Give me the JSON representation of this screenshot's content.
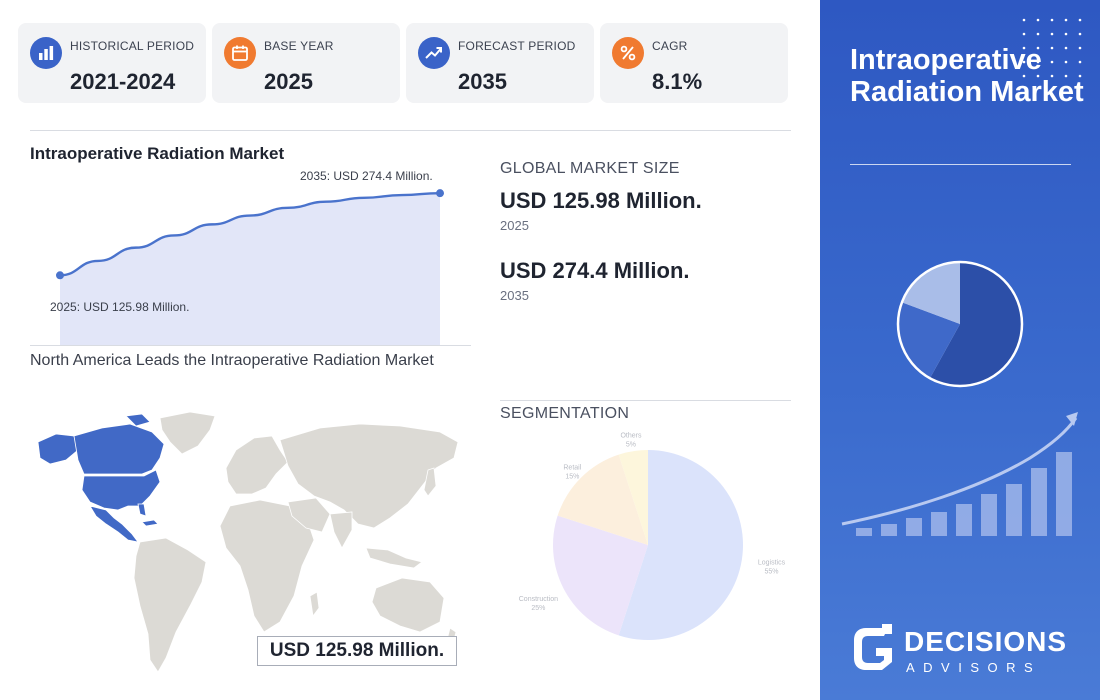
{
  "stats": [
    {
      "label": "HISTORICAL PERIOD",
      "value": "2021-2024",
      "icon": "bar-chart-icon",
      "color": "#3a63c8"
    },
    {
      "label": "BASE YEAR",
      "value": "2025",
      "icon": "calendar-icon",
      "color": "#f07a30"
    },
    {
      "label": "FORECAST PERIOD",
      "value": "2035",
      "icon": "trend-up-icon",
      "color": "#3a63c8"
    },
    {
      "label": "CAGR",
      "value": "8.1%",
      "icon": "percent-icon",
      "color": "#f07a30"
    }
  ],
  "market_chart": {
    "title": "Intraoperative Radiation Market",
    "start_label": "2025: USD 125.98 Million.",
    "end_label": "2035: USD 274.4 Million."
  },
  "market_size": {
    "heading": "GLOBAL MARKET SIZE",
    "value_2025": "USD 125.98 Million.",
    "year_2025": "2025",
    "value_2035": "USD 274.4 Million.",
    "year_2035": "2035"
  },
  "map": {
    "title": "North America Leads the Intraoperative Radiation Market",
    "badge": "USD 125.98 Million.",
    "highlight_color": "#4169c6",
    "base_color": "#dcdad5"
  },
  "segmentation": {
    "heading": "SEGMENTATION"
  },
  "panel": {
    "title": "Intraoperative Radiation Market",
    "logo_main": "DECISIONS",
    "logo_sub": "ADVISORS"
  },
  "chart_data": [
    {
      "type": "area",
      "title": "Intraoperative Radiation Market",
      "x": [
        2025,
        2026,
        2027,
        2028,
        2029,
        2030,
        2031,
        2032,
        2033,
        2034,
        2035
      ],
      "y": [
        125.98,
        152,
        176,
        198,
        218,
        234,
        248,
        259,
        266,
        271,
        274.4
      ],
      "unit": "USD Million",
      "point_labels": {
        "2025": "2025: USD 125.98 Million.",
        "2035": "2035: USD 274.4 Million."
      },
      "color": "#4a73cc",
      "fill": "#e2e6f8"
    },
    {
      "type": "pie",
      "categories": [
        "Logistics",
        "Construction",
        "Retail",
        "Others"
      ],
      "values": [
        55,
        25,
        15,
        5
      ],
      "labels": [
        "Logistics\n55%",
        "Construction\n25%",
        "Retail\n15%",
        "Others\n5%"
      ],
      "colors": [
        "#dbe3fb",
        "#ece4fa",
        "#fcefdd",
        "#fdf6dc"
      ]
    }
  ]
}
